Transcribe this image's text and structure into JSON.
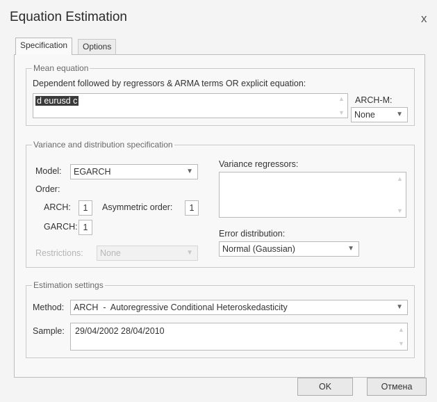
{
  "window": {
    "title": "Equation Estimation",
    "close_label": "x"
  },
  "tabs": [
    {
      "label": "Specification",
      "active": true
    },
    {
      "label": "Options",
      "active": false
    }
  ],
  "mean_equation": {
    "legend": "Mean equation",
    "instruction": "Dependent followed by regressors & ARMA terms OR explicit equation:",
    "equation_value": "d eurusd c",
    "archm_label": "ARCH-M:",
    "archm_value": "None"
  },
  "variance": {
    "legend": "Variance and distribution specification",
    "model_label": "Model:",
    "model_value": "EGARCH",
    "order_label": "Order:",
    "arch_label": "ARCH:",
    "arch_value": "1",
    "asym_label": "Asymmetric order:",
    "asym_value": "1",
    "garch_label": "GARCH:",
    "garch_value": "1",
    "restrictions_label": "Restrictions:",
    "restrictions_value": "None",
    "regressors_label": "Variance regressors:",
    "regressors_value": "",
    "error_dist_label": "Error distribution:",
    "error_dist_value": "Normal (Gaussian)"
  },
  "estimation": {
    "legend": "Estimation settings",
    "method_label": "Method:",
    "method_value": "ARCH  -  Autoregressive Conditional Heteroskedasticity",
    "sample_label": "Sample:",
    "sample_value": "29/04/2002 28/04/2010"
  },
  "buttons": {
    "ok": "OK",
    "cancel": "Отмена"
  }
}
